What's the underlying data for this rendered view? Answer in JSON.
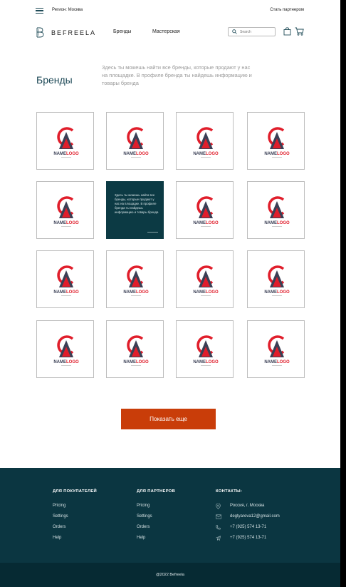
{
  "topbar": {
    "region": "Регион: Москва",
    "partner_link": "Стать партнером"
  },
  "header": {
    "logo_text": "BEFREELA",
    "nav": [
      "Бренды",
      "Мастерская"
    ],
    "search_placeholder": "Search"
  },
  "intro": {
    "title": "Бренды",
    "description": "Здесь ты можешь найти все бренды, которые продают у нас на площадке. В профиле бренда ты найдешь информацию и товары бренда"
  },
  "brands": {
    "logo_name_left": "NAME",
    "logo_name_right": "LOGO",
    "hover_text": "Здесь ты можешь найти все бренды, которые продают у нас на площадке. В профиле бренда ты найдешь информацию и товары бренда",
    "count": 16,
    "hover_index": 5
  },
  "load_more": "Показать еще",
  "footer": {
    "buyers": {
      "heading": "ДЛЯ ПОКУПАТЕЛЕЙ",
      "links": [
        "Pricing",
        "Settings",
        "Orders",
        "Help"
      ]
    },
    "partners": {
      "heading": "ДЛЯ ПАРТНЕРОВ",
      "links": [
        "Pricing",
        "Settings",
        "Orders",
        "Help"
      ]
    },
    "contacts": {
      "heading": "КОНТАКТЫ:",
      "items": [
        {
          "icon": "location-icon",
          "text": "Россия, г. Москва"
        },
        {
          "icon": "mail-icon",
          "text": "degtyareva12@gmail.com"
        },
        {
          "icon": "phone-icon",
          "text": "+7 (925) 574 13-71"
        },
        {
          "icon": "telegram-icon",
          "text": "+7 (925) 574 13-71"
        }
      ]
    },
    "copyright": "@2022 Befreela"
  },
  "colors": {
    "brand_dark": "#0b3641",
    "accent": "#c93d09",
    "logo_red": "#e01e2b",
    "logo_dark": "#3a3f55"
  }
}
